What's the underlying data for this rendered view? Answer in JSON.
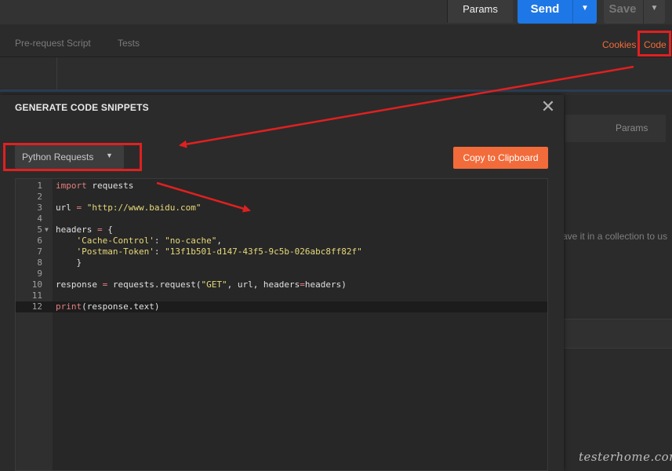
{
  "top_bar": {
    "params_label": "Params",
    "send_label": "Send",
    "save_label": "Save"
  },
  "request_tabs": {
    "pre_request": "Pre-request Script",
    "tests": "Tests",
    "cookies": "Cookies",
    "code": "Code"
  },
  "background": {
    "params_label": "Params",
    "save_hint": "ave it in a collection to us",
    "watermark": "testerhome.com"
  },
  "modal": {
    "title": "GENERATE CODE SNIPPETS",
    "language_selected": "Python Requests",
    "copy_button": "Copy to Clipboard"
  },
  "code_lines": [
    {
      "n": "1",
      "text": "import requests"
    },
    {
      "n": "2",
      "text": ""
    },
    {
      "n": "3",
      "text": "url = \"http://www.baidu.com\""
    },
    {
      "n": "4",
      "text": ""
    },
    {
      "n": "5",
      "text": "headers = {"
    },
    {
      "n": "6",
      "text": "    'Cache-Control': \"no-cache\","
    },
    {
      "n": "7",
      "text": "    'Postman-Token': \"13f1b501-d147-43f5-9c5b-026abc8ff82f\""
    },
    {
      "n": "8",
      "text": "    }"
    },
    {
      "n": "9",
      "text": ""
    },
    {
      "n": "10",
      "text": "response = requests.request(\"GET\", url, headers=headers)"
    },
    {
      "n": "11",
      "text": ""
    },
    {
      "n": "12",
      "text": "print(response.text)"
    }
  ],
  "colors": {
    "accent_orange": "#f26b3a",
    "send_blue": "#1e77e6",
    "annotation_red": "#e02020"
  }
}
